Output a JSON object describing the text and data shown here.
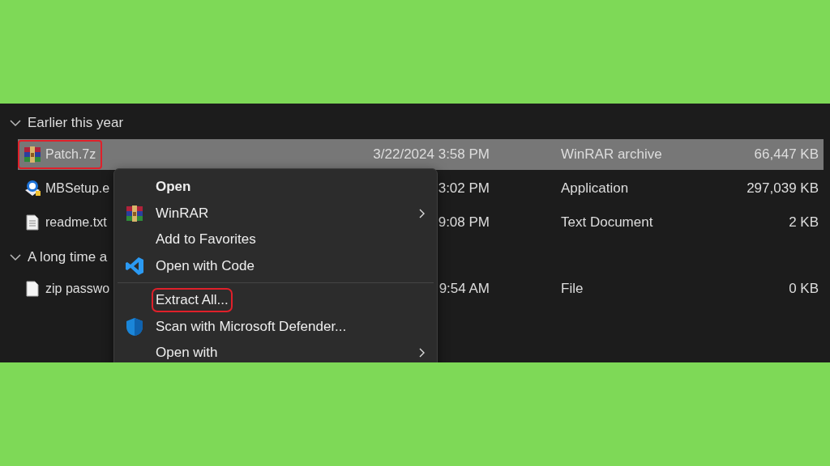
{
  "groups": [
    {
      "title": "Earlier this year",
      "expanded": true,
      "rows": [
        {
          "name": "Patch.7z",
          "kind": "archive",
          "date": "3/22/2024 3:58 PM",
          "type": "WinRAR archive",
          "size": "66,447 KB",
          "selected": true,
          "highlighted": true
        },
        {
          "name": "MBSetup.e",
          "kind": "installer",
          "date": "3:02 PM",
          "type": "Application",
          "size": "297,039 KB",
          "selected": false,
          "highlighted": false
        },
        {
          "name": "readme.txt",
          "kind": "text",
          "date": "9:08 PM",
          "type": "Text Document",
          "size": "2 KB",
          "selected": false,
          "highlighted": false
        }
      ]
    },
    {
      "title": "A long time a",
      "expanded": true,
      "rows": [
        {
          "name": "zip passwo",
          "kind": "file",
          "date": "9:54 AM",
          "type": "File",
          "size": "0 KB",
          "selected": false,
          "highlighted": false
        }
      ]
    }
  ],
  "context_menu": {
    "items": [
      {
        "kind": "plain",
        "label": "Open",
        "default": true,
        "submenu": false,
        "highlighted": false
      },
      {
        "kind": "archive",
        "label": "WinRAR",
        "default": false,
        "submenu": true,
        "highlighted": false
      },
      {
        "kind": "plain",
        "label": "Add to Favorites",
        "default": false,
        "submenu": false,
        "highlighted": false
      },
      {
        "kind": "code",
        "label": "Open with Code",
        "default": false,
        "submenu": false,
        "highlighted": false
      },
      {
        "kind": "separator"
      },
      {
        "kind": "plain",
        "label": "Extract All...",
        "default": false,
        "submenu": false,
        "highlighted": true
      },
      {
        "kind": "shield",
        "label": "Scan with Microsoft Defender...",
        "default": false,
        "submenu": false,
        "highlighted": false
      },
      {
        "kind": "plain",
        "label": "Open with",
        "default": false,
        "submenu": true,
        "highlighted": false
      }
    ]
  }
}
